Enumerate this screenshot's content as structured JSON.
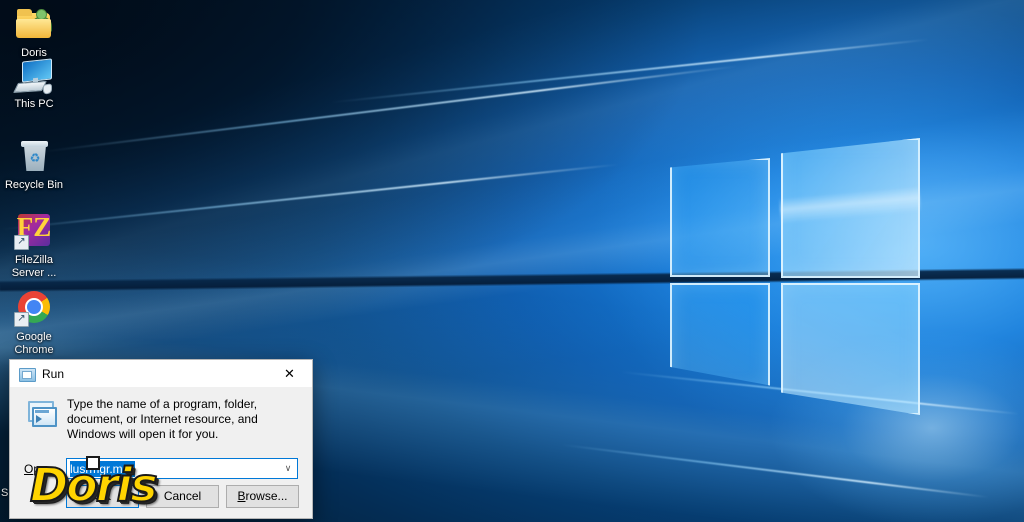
{
  "desktop": {
    "icons": [
      {
        "id": "doris-folder",
        "label": "Doris",
        "icon": "user-folder-icon",
        "shortcut": false
      },
      {
        "id": "this-pc",
        "label": "This PC",
        "icon": "computer-monitor-icon",
        "shortcut": false
      },
      {
        "id": "recycle-bin",
        "label": "Recycle Bin",
        "icon": "recycle-bin-icon",
        "shortcut": false,
        "glyph": "♻"
      },
      {
        "id": "filezilla-server",
        "label": "FileZilla\nServer ...",
        "icon": "filezilla-icon",
        "shortcut": true,
        "glyph": "↗",
        "letter": "FZ"
      },
      {
        "id": "google-chrome",
        "label": "Google\nChrome",
        "icon": "chrome-icon",
        "shortcut": true,
        "glyph": "↗"
      }
    ],
    "hidden_icon_partial_label": "S"
  },
  "run_dialog": {
    "title": "Run",
    "title_icon": "run-window-icon",
    "close_glyph": "✕",
    "description": "Type the name of a program, folder, document, or Internet resource, and Windows will open it for you.",
    "open_label": "Open:",
    "open_label_accesskey": "O",
    "input_value": "lusrmgr.msc",
    "input_selected": true,
    "combo_arrow_glyph": "∨",
    "buttons": [
      {
        "id": "ok",
        "label": "OK",
        "default": true,
        "accesskey": ""
      },
      {
        "id": "cancel",
        "label": "Cancel",
        "default": false,
        "accesskey": ""
      },
      {
        "id": "browse",
        "label": "Browse...",
        "default": false,
        "accesskey": "B"
      }
    ]
  },
  "watermark": {
    "text": "Doris"
  },
  "colors": {
    "accent": "#0078d7",
    "selection": "#0078d7",
    "dialog_bg": "#f0f0f0",
    "titlebar_bg": "#ffffff",
    "button_bg": "#e1e1e1",
    "watermark_yellow": "#ffd400",
    "wallpaper_deep": "#031629",
    "wallpaper_bright": "#2196f3"
  }
}
